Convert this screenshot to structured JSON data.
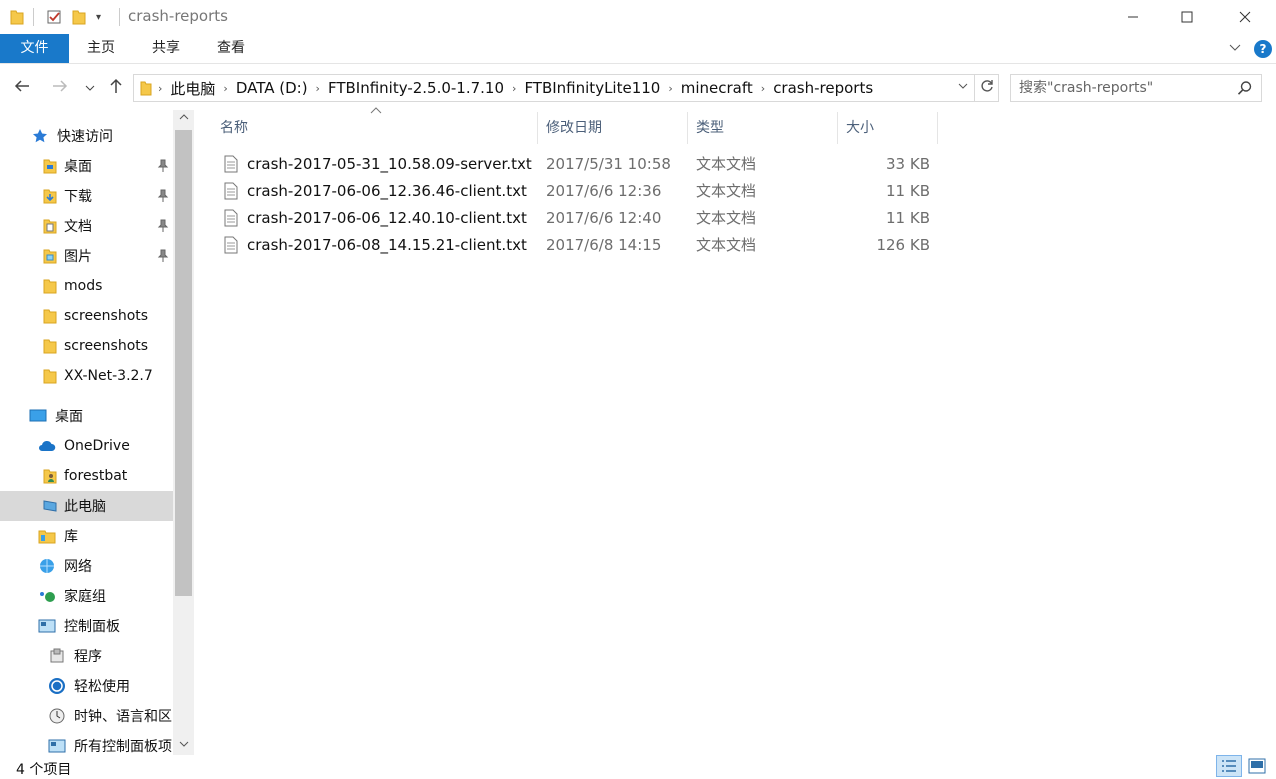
{
  "window": {
    "title": "crash-reports"
  },
  "ribbon": {
    "tabs": [
      {
        "label": "文件"
      },
      {
        "label": "主页"
      },
      {
        "label": "共享"
      },
      {
        "label": "查看"
      }
    ],
    "help_label": "?"
  },
  "nav": {
    "breadcrumbs": [
      "此电脑",
      "DATA (D:)",
      "FTBInfinity-2.5.0-1.7.10",
      "FTBInfinityLite110",
      "minecraft",
      "crash-reports"
    ],
    "search_placeholder": "搜索\"crash-reports\""
  },
  "sidebar": {
    "items": [
      {
        "label": "快速访问",
        "icon": "star-icon"
      },
      {
        "label": "桌面",
        "icon": "desktop-folder-icon",
        "pinned": true
      },
      {
        "label": "下载",
        "icon": "download-folder-icon",
        "pinned": true
      },
      {
        "label": "文档",
        "icon": "documents-folder-icon",
        "pinned": true
      },
      {
        "label": "图片",
        "icon": "pictures-folder-icon",
        "pinned": true
      },
      {
        "label": "mods",
        "icon": "folder-icon"
      },
      {
        "label": "screenshots",
        "icon": "folder-icon"
      },
      {
        "label": "screenshots",
        "icon": "folder-icon"
      },
      {
        "label": "XX-Net-3.2.7",
        "icon": "folder-icon"
      },
      {
        "label": "桌面",
        "icon": "desktop-icon"
      },
      {
        "label": "OneDrive",
        "icon": "cloud-icon"
      },
      {
        "label": "forestbat",
        "icon": "user-icon"
      },
      {
        "label": "此电脑",
        "icon": "computer-icon",
        "selected": true
      },
      {
        "label": "库",
        "icon": "library-icon"
      },
      {
        "label": "网络",
        "icon": "network-icon"
      },
      {
        "label": "家庭组",
        "icon": "homegroup-icon"
      },
      {
        "label": "控制面板",
        "icon": "control-panel-icon"
      },
      {
        "label": "程序",
        "icon": "programs-icon"
      },
      {
        "label": "轻松使用",
        "icon": "ease-of-access-icon"
      },
      {
        "label": "时钟、语言和区",
        "icon": "clock-icon"
      },
      {
        "label": "所有控制面板项",
        "icon": "control-panel-icon"
      }
    ]
  },
  "files": {
    "columns": {
      "name": "名称",
      "date": "修改日期",
      "type": "类型",
      "size": "大小"
    },
    "rows": [
      {
        "name": "crash-2017-05-31_10.58.09-server.txt",
        "date": "2017/5/31 10:58",
        "type": "文本文档",
        "size": "33 KB"
      },
      {
        "name": "crash-2017-06-06_12.36.46-client.txt",
        "date": "2017/6/6 12:36",
        "type": "文本文档",
        "size": "11 KB"
      },
      {
        "name": "crash-2017-06-06_12.40.10-client.txt",
        "date": "2017/6/6 12:40",
        "type": "文本文档",
        "size": "11 KB"
      },
      {
        "name": "crash-2017-06-08_14.15.21-client.txt",
        "date": "2017/6/8 14:15",
        "type": "文本文档",
        "size": "126 KB"
      }
    ]
  },
  "status": {
    "item_count": "4 个项目"
  },
  "colors": {
    "accent": "#1979ca",
    "selected_bg": "#d9d9d9",
    "folder": "#f5c84a"
  }
}
